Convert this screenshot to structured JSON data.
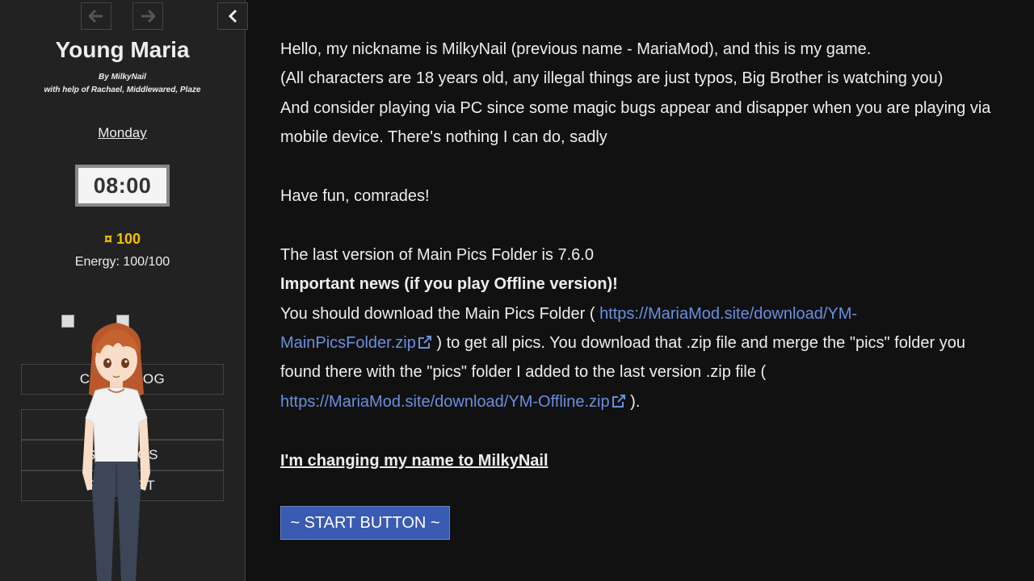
{
  "sidebar": {
    "title": "Young Maria",
    "byline_1": "By MilkyNail",
    "byline_2": "with help of Rachael, Middlewared, Plaze",
    "day": "Monday",
    "time": "08:00",
    "money": "¤ 100",
    "energy": "Energy: 100/100",
    "menu": {
      "codex": "CODEX LOG",
      "saves": "SAVES",
      "settings": "SETTINGS",
      "restart": "RESTART"
    },
    "icons": {
      "back": "arrow-left-icon",
      "forward": "arrow-right-icon",
      "stow": "chevron-left-icon"
    }
  },
  "passage": {
    "line_1": "Hello, my nickname is MilkyNail (previous name - MariaMod), and this is my game.",
    "line_2": "(All characters are 18 years old, any illegal things are just typos, Big Brother is watching you)",
    "line_3": "And consider playing via PC since some magic bugs appear and disapper when you are playing via mobile device. There's nothing I can do, sadly",
    "line_4": "Have fun, comrades!",
    "line_5": "The last version of Main Pics Folder is 7.6.0",
    "line_6": "Important news (if you play Offline version)!",
    "download_intro": "You should download the Main Pics Folder (",
    "link_1": "https://MariaMod.site/download/YM-MainPicsFolder.zip",
    "download_middle": ") to get all pics. You download that .zip file and merge the \"pics\" folder you found there with the \"pics\" folder I added to the last version .zip file (",
    "link_2": "https://MariaMod.site/download/YM-Offline.zip",
    "download_end": ").",
    "name_change": "I'm changing my name to MilkyNail",
    "start_button": "~ START BUTTON ~"
  },
  "colors": {
    "background": "#111111",
    "sidebar": "#222222",
    "link": "#6a8fe0",
    "money": "#f2c200",
    "start_button": "#3a5bb2"
  }
}
